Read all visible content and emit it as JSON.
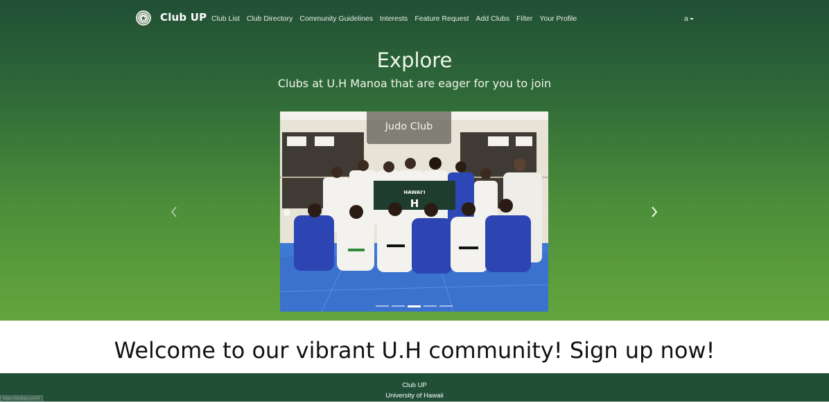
{
  "brand": {
    "name": "Club UP",
    "logo": "university-seal-icon"
  },
  "nav": {
    "links": [
      "Club List",
      "Club Directory",
      "Community Guidelines",
      "Interests",
      "Feature Request",
      "Add Clubs",
      "Filter",
      "Your Profile"
    ],
    "user": "a"
  },
  "hero": {
    "title": "Explore",
    "subtitle": "Clubs at U.H Manoa that are eager for you to join"
  },
  "carousel": {
    "active_caption": "Judo Club",
    "slide_count": 5,
    "active_index": 2,
    "banner_text": "HAWAI'I",
    "banner_letter": "H",
    "prev_icon": "chevron-left-icon",
    "next_icon": "chevron-right-icon"
  },
  "welcome": {
    "text": "Welcome to our vibrant U.H community! Sign up now!"
  },
  "footer": {
    "line1": "Club UP",
    "line2": "University of Hawaii"
  },
  "status_bar": {
    "url": "https://clubup.com/#"
  },
  "colors": {
    "hero_top": "#214f36",
    "hero_bottom": "#63a63d",
    "footer_bg": "#214f36",
    "welcome_bg": "#ffffff"
  }
}
